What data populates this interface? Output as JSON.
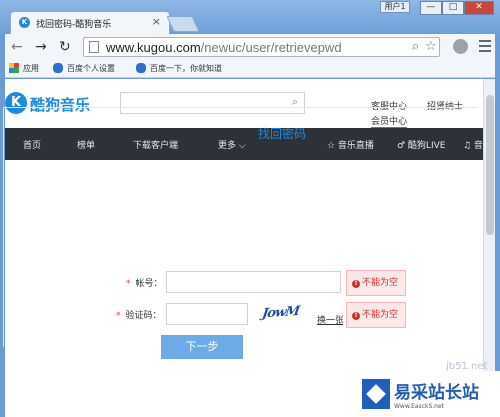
{
  "browser": {
    "user_badge": "用户1",
    "window_buttons": [
      "—",
      "□",
      "✕"
    ],
    "tab": {
      "title": "找回密码-酷狗音乐",
      "close": "×"
    },
    "url": {
      "host": "www.kugou.com",
      "path": "/newuc/user/retrievepwd"
    },
    "bookmarks": [
      "应用",
      "百度个人设置",
      "百度一下，你就知道"
    ]
  },
  "site": {
    "logo_letter": "K",
    "logo_text": "酷狗音乐",
    "search_placeholder": "",
    "top_links": [
      "客服中心",
      "招贤纳士",
      "会员中心"
    ],
    "nav": [
      "首页",
      "榜单",
      "下载客户端",
      "更多 ⌵",
      "☆ 音乐直播",
      "♂ 酷狗LIVE",
      "♫ 音"
    ]
  },
  "form": {
    "title": "找回密码",
    "required_mark": "*",
    "account_label": "帐号：",
    "account_value": "",
    "captcha_label": "验证码：",
    "captcha_value": "",
    "captcha_image_text": "JowM",
    "refresh_link": "换一张",
    "error_text": "不能为空",
    "error_icon": "!",
    "submit_label": "下一步"
  },
  "watermark": {
    "name": "易采站长站",
    "subtitle": "Www.EasckS.net",
    "faded": "jb51.net"
  },
  "colors": {
    "accent": "#1a8ae5",
    "nav_bg": "#2d3239",
    "error": "#d32f2f",
    "button": "#6cabe8"
  }
}
